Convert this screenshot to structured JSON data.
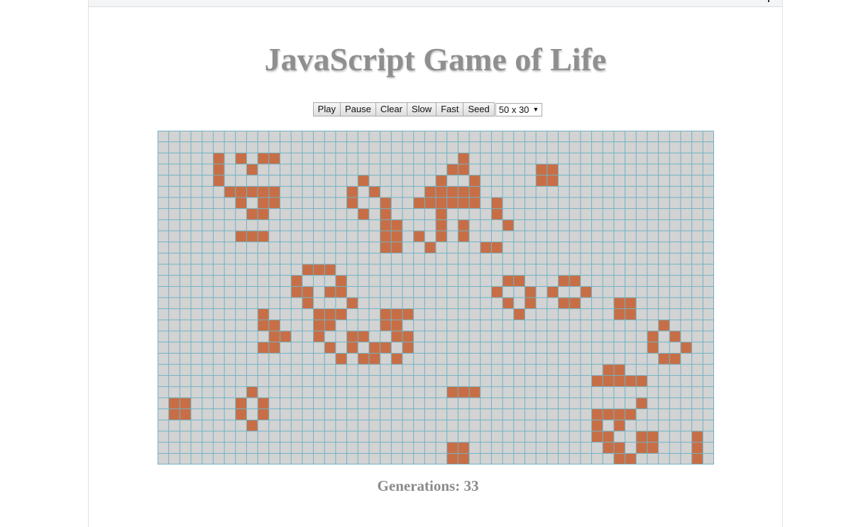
{
  "title": "JavaScript Game of Life",
  "controls": {
    "play": "Play",
    "pause": "Pause",
    "clear": "Clear",
    "slow": "Slow",
    "fast": "Fast",
    "seed": "Seed",
    "size_select": "50 x 30",
    "size_select_icon": "chevron-down-icon"
  },
  "grid": {
    "columns": 50,
    "rows": 30,
    "colors": {
      "dead": "#d3d3d3",
      "alive": "#c86e46",
      "gridline": "#6fb3c4"
    },
    "alive_cells": [
      [
        2,
        5
      ],
      [
        2,
        7
      ],
      [
        2,
        9
      ],
      [
        2,
        10
      ],
      [
        3,
        5
      ],
      [
        3,
        8
      ],
      [
        4,
        5
      ],
      [
        5,
        6
      ],
      [
        5,
        7
      ],
      [
        5,
        8
      ],
      [
        5,
        9
      ],
      [
        5,
        10
      ],
      [
        6,
        7
      ],
      [
        6,
        9
      ],
      [
        6,
        10
      ],
      [
        7,
        8
      ],
      [
        7,
        9
      ],
      [
        9,
        7
      ],
      [
        9,
        8
      ],
      [
        9,
        9
      ],
      [
        2,
        27
      ],
      [
        3,
        26
      ],
      [
        3,
        27
      ],
      [
        4,
        25
      ],
      [
        4,
        28
      ],
      [
        5,
        24
      ],
      [
        5,
        25
      ],
      [
        5,
        26
      ],
      [
        5,
        27
      ],
      [
        5,
        28
      ],
      [
        6,
        23
      ],
      [
        6,
        24
      ],
      [
        6,
        25
      ],
      [
        6,
        26
      ],
      [
        6,
        27
      ],
      [
        6,
        28
      ],
      [
        7,
        25
      ],
      [
        8,
        25
      ],
      [
        9,
        25
      ],
      [
        10,
        24
      ],
      [
        8,
        27
      ],
      [
        9,
        27
      ],
      [
        9,
        23
      ],
      [
        10,
        24
      ],
      [
        3,
        34
      ],
      [
        3,
        35
      ],
      [
        4,
        34
      ],
      [
        4,
        35
      ],
      [
        4,
        18
      ],
      [
        5,
        17
      ],
      [
        5,
        19
      ],
      [
        6,
        17
      ],
      [
        6,
        20
      ],
      [
        7,
        18
      ],
      [
        7,
        20
      ],
      [
        8,
        20
      ],
      [
        8,
        21
      ],
      [
        9,
        20
      ],
      [
        9,
        21
      ],
      [
        10,
        20
      ],
      [
        10,
        21
      ],
      [
        6,
        30
      ],
      [
        7,
        30
      ],
      [
        8,
        31
      ],
      [
        10,
        29
      ],
      [
        10,
        30
      ],
      [
        12,
        13
      ],
      [
        12,
        14
      ],
      [
        12,
        15
      ],
      [
        13,
        12
      ],
      [
        13,
        16
      ],
      [
        14,
        12
      ],
      [
        14,
        13
      ],
      [
        14,
        15
      ],
      [
        14,
        16
      ],
      [
        15,
        13
      ],
      [
        15,
        17
      ],
      [
        16,
        14
      ],
      [
        16,
        15
      ],
      [
        16,
        16
      ],
      [
        17,
        14
      ],
      [
        17,
        15
      ],
      [
        18,
        14
      ],
      [
        18,
        17
      ],
      [
        18,
        18
      ],
      [
        19,
        15
      ],
      [
        19,
        17
      ],
      [
        19,
        19
      ],
      [
        20,
        16
      ],
      [
        20,
        18
      ],
      [
        20,
        19
      ],
      [
        16,
        20
      ],
      [
        16,
        21
      ],
      [
        16,
        22
      ],
      [
        17,
        20
      ],
      [
        17,
        21
      ],
      [
        18,
        21
      ],
      [
        18,
        22
      ],
      [
        19,
        20
      ],
      [
        19,
        22
      ],
      [
        20,
        21
      ],
      [
        16,
        9
      ],
      [
        17,
        9
      ],
      [
        17,
        10
      ],
      [
        18,
        10
      ],
      [
        18,
        11
      ],
      [
        19,
        9
      ],
      [
        19,
        10
      ],
      [
        13,
        31
      ],
      [
        13,
        32
      ],
      [
        14,
        30
      ],
      [
        14,
        33
      ],
      [
        15,
        31
      ],
      [
        15,
        33
      ],
      [
        16,
        32
      ],
      [
        13,
        36
      ],
      [
        13,
        37
      ],
      [
        14,
        35
      ],
      [
        14,
        38
      ],
      [
        15,
        36
      ],
      [
        15,
        37
      ],
      [
        15,
        41
      ],
      [
        15,
        42
      ],
      [
        16,
        41
      ],
      [
        16,
        42
      ],
      [
        17,
        45
      ],
      [
        18,
        44
      ],
      [
        18,
        46
      ],
      [
        19,
        44
      ],
      [
        19,
        47
      ],
      [
        20,
        45
      ],
      [
        20,
        46
      ],
      [
        21,
        40
      ],
      [
        21,
        41
      ],
      [
        22,
        39
      ],
      [
        22,
        40
      ],
      [
        22,
        41
      ],
      [
        22,
        42
      ],
      [
        22,
        43
      ],
      [
        24,
        43
      ],
      [
        25,
        39
      ],
      [
        25,
        40
      ],
      [
        25,
        41
      ],
      [
        25,
        42
      ],
      [
        26,
        39
      ],
      [
        26,
        41
      ],
      [
        27,
        39
      ],
      [
        27,
        40
      ],
      [
        27,
        43
      ],
      [
        27,
        44
      ],
      [
        28,
        40
      ],
      [
        28,
        41
      ],
      [
        28,
        43
      ],
      [
        28,
        44
      ],
      [
        29,
        41
      ],
      [
        29,
        42
      ],
      [
        27,
        48
      ],
      [
        28,
        48
      ],
      [
        29,
        48
      ],
      [
        23,
        26
      ],
      [
        23,
        27
      ],
      [
        23,
        28
      ],
      [
        24,
        1
      ],
      [
        24,
        2
      ],
      [
        25,
        1
      ],
      [
        25,
        2
      ],
      [
        23,
        8
      ],
      [
        24,
        7
      ],
      [
        24,
        9
      ],
      [
        25,
        7
      ],
      [
        25,
        9
      ],
      [
        26,
        8
      ],
      [
        28,
        26
      ],
      [
        28,
        27
      ],
      [
        29,
        26
      ],
      [
        29,
        27
      ]
    ]
  },
  "status": {
    "generations_label": "Generations: 33"
  }
}
